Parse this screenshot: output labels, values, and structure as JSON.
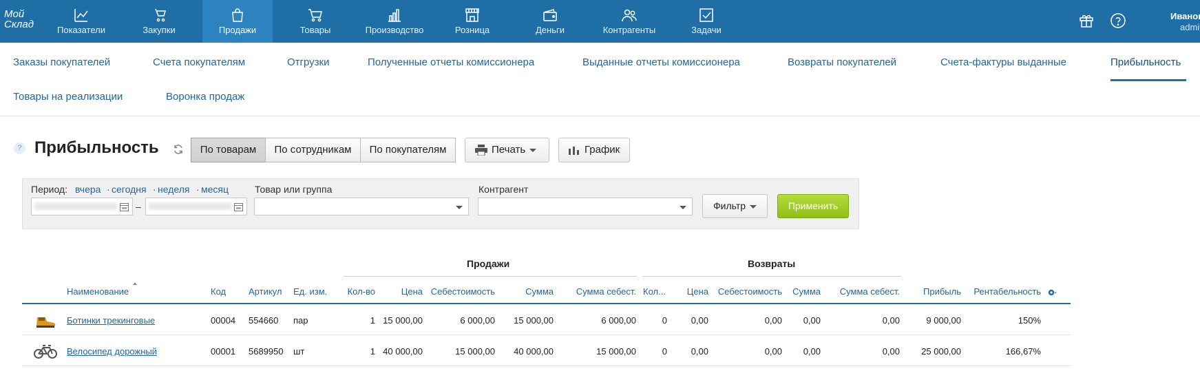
{
  "app": {
    "logo_line1": "Мой",
    "logo_line2": "Склад"
  },
  "topnav": [
    {
      "label": "Показатели",
      "icon": "chart-line-icon"
    },
    {
      "label": "Закупки",
      "icon": "basket-icon"
    },
    {
      "label": "Продажи",
      "icon": "bag-icon",
      "active": true
    },
    {
      "label": "Товары",
      "icon": "cart-icon"
    },
    {
      "label": "Производство",
      "icon": "factory-icon"
    },
    {
      "label": "Розница",
      "icon": "store-icon"
    },
    {
      "label": "Деньги",
      "icon": "wallet-icon"
    },
    {
      "label": "Контрагенты",
      "icon": "people-icon"
    },
    {
      "label": "Задачи",
      "icon": "checkbox-icon"
    }
  ],
  "user": {
    "name": "Иванов",
    "login": "admin"
  },
  "subnav": [
    "Заказы покупателей",
    "Счета покупателям",
    "Отгрузки",
    "Полученные отчеты комиссионера",
    "Выданные отчеты комиссионера",
    "Возвраты покупателей",
    "Счета-фактуры выданные",
    "Прибыльность",
    "Товары на реализации",
    "Воронка продаж"
  ],
  "page": {
    "title": "Прибыльность",
    "segments": [
      "По товарам",
      "По сотрудникам",
      "По покупателям"
    ],
    "active_segment": 0,
    "print_label": "Печать",
    "chart_label": "График"
  },
  "filter": {
    "period_label": "Период:",
    "period_links": [
      "вчера",
      "сегодня",
      "неделя",
      "месяц"
    ],
    "dash": "–",
    "product_label": "Товар или группа",
    "counterparty_label": "Контрагент",
    "filter_button": "Фильтр",
    "apply_button": "Применить"
  },
  "table": {
    "group_sales": "Продажи",
    "group_returns": "Возвраты",
    "columns": [
      "Наименование",
      "Код",
      "Артикул",
      "Ед. изм.",
      "Кол-во",
      "Цена",
      "Себестоимость",
      "Сумма",
      "Сумма себест.",
      "Кол...",
      "Цена",
      "Себестоимость",
      "Сумма",
      "Сумма себест.",
      "Прибыль",
      "Рентабельность"
    ],
    "rows": [
      {
        "thumb": "boots-icon",
        "cells": [
          "Ботинки трекинговые",
          "00004",
          "554660",
          "пар",
          "1",
          "15 000,00",
          "6 000,00",
          "15 000,00",
          "6 000,00",
          "0",
          "0,00",
          "0,00",
          "0,00",
          "0,00",
          "9 000,00",
          "150%"
        ]
      },
      {
        "thumb": "bicycle-icon",
        "cells": [
          "Велосипед дорожный",
          "00001",
          "5689950",
          "шт",
          "1",
          "40 000,00",
          "15 000,00",
          "40 000,00",
          "15 000,00",
          "0",
          "0,00",
          "0,00",
          "0,00",
          "0,00",
          "25 000,00",
          "166,67%"
        ]
      }
    ]
  },
  "colors": {
    "topbar": "#1f6fa6",
    "topbar_active": "#2d83bf",
    "link": "#2166a0",
    "apply_green": "#9acb1f"
  }
}
